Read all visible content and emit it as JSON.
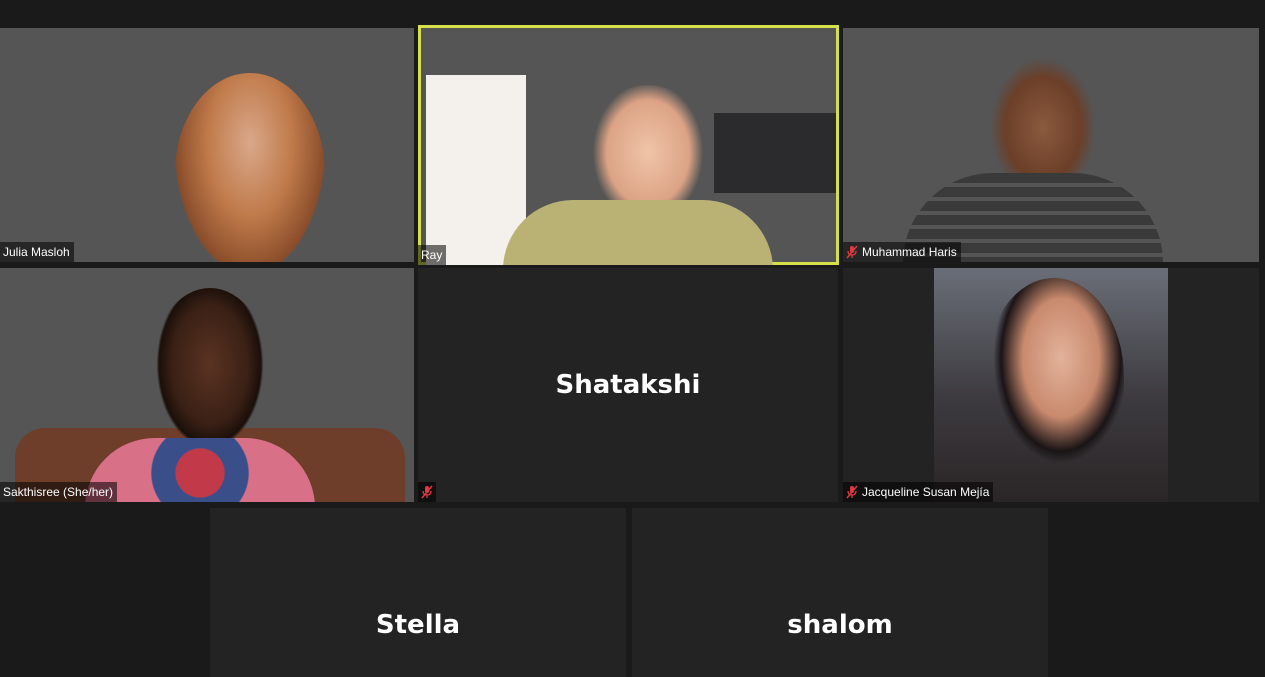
{
  "participants": [
    {
      "name": "Julia Masloh",
      "muted": false,
      "video": true
    },
    {
      "name": "Ray",
      "muted": false,
      "video": true,
      "active_speaker": true
    },
    {
      "name": "Muhammad Haris",
      "muted": true,
      "video": true
    },
    {
      "name": "Sakthisree (She/her)",
      "muted": false,
      "video": true
    },
    {
      "name": "Shatakshi",
      "muted": true,
      "video": false
    },
    {
      "name": "Jacqueline Susan Mejía",
      "muted": true,
      "video": true
    },
    {
      "name": "Stella",
      "muted": false,
      "video": false
    },
    {
      "name": "shalom",
      "muted": false,
      "video": false
    }
  ],
  "colors": {
    "background": "#1a1a1a",
    "tile": "#232323",
    "active_border": "#d6e04a",
    "mute_icon": "#e0393e"
  },
  "icons": {
    "mute": "microphone-muted-icon"
  }
}
